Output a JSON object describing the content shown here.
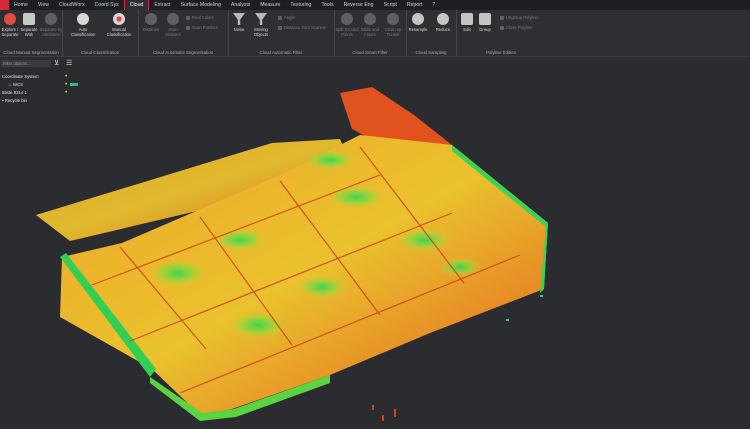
{
  "menu": {
    "tabs": [
      {
        "label": "Home"
      },
      {
        "label": "View"
      },
      {
        "label": "CloudWorx"
      },
      {
        "label": "Coord Sys"
      },
      {
        "label": "Cloud",
        "active": true
      },
      {
        "label": "Extract"
      },
      {
        "label": "Surface Modeling"
      },
      {
        "label": "Analysis"
      },
      {
        "label": "Measure"
      },
      {
        "label": "Texturing"
      },
      {
        "label": "Tools"
      },
      {
        "label": "Reverse Eng"
      },
      {
        "label": "Script"
      },
      {
        "label": "Report"
      },
      {
        "label": "?"
      }
    ]
  },
  "ribbon": {
    "groups": {
      "manual_seg": {
        "title": "Cloud Manual Segmentation",
        "btn1": "Explore /\nSeparate",
        "btn2": "Separate\nWith",
        "btn3": "Separate by\nAttributes"
      },
      "classification": {
        "title": "Cloud Classification",
        "btn1": "Auto\nClassification",
        "btn2": "Manual\nClassification"
      },
      "auto_seg": {
        "title": "Cloud Automatic Segmentation",
        "btn1": "Distance",
        "btn2": "Scan\nStations",
        "small1": "Real Colors",
        "small2": "Scan Patches"
      },
      "auto_filter": {
        "title": "Cloud Automatic Filter",
        "btn1": "Noise",
        "btn2": "Moving\nObjects",
        "small1": "Angle",
        "small2": "Distance from Scanner"
      },
      "smart_filter": {
        "title": "Cloud Smart Filter",
        "btn1": "Split Ground\nPoints",
        "btn2": "Walls and\nFloors",
        "btn3": "Clean up\nTunnel"
      },
      "sampling": {
        "title": "Cloud Sampling",
        "btn1": "Resample",
        "btn2": "Reduce"
      },
      "polyline": {
        "title": "Polyline Edition",
        "btn1": "Edit",
        "btn2": "Group",
        "small1": "Ungroup Polyline",
        "small2": "Close Polyline"
      }
    }
  },
  "panel": {
    "filter_placeholder": "Filter objects...",
    "tree": {
      "coord_system": "Coordinate System",
      "wcs": "WCS",
      "scan": "55ste 8314 1",
      "recycle": "Recycle bin"
    }
  },
  "viewport": {
    "colors": {
      "background": "#2b2c30",
      "high": "#e83a1c",
      "mid": "#f2c12a",
      "low": "#2fd65a"
    }
  }
}
